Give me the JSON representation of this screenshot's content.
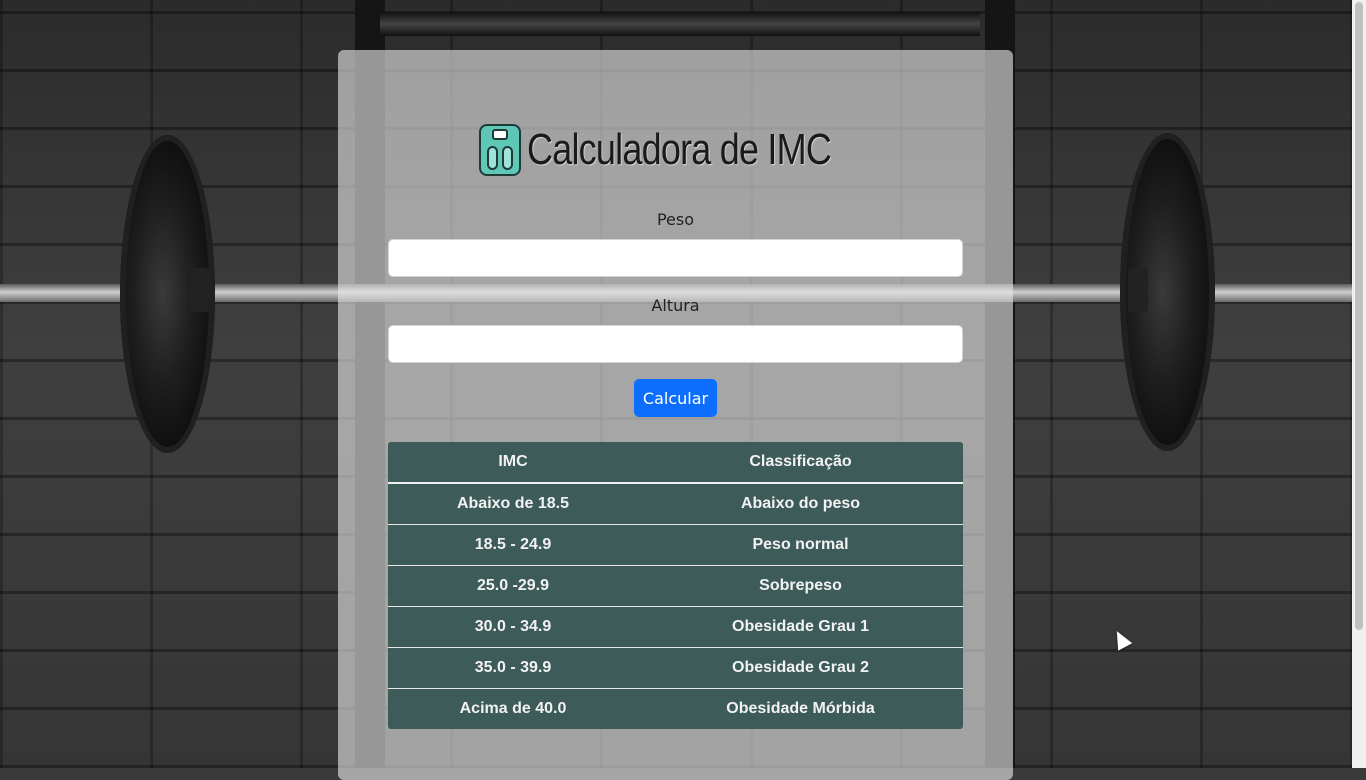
{
  "app": {
    "title": "Calculadora de IMC",
    "logo_icon": "scale-icon"
  },
  "form": {
    "peso_label": "Peso",
    "peso_value": "",
    "altura_label": "Altura",
    "altura_value": "",
    "calc_button": "Calcular",
    "accent_color": "#0d6efd"
  },
  "table": {
    "headers": [
      "IMC",
      "Classificação"
    ],
    "rows": [
      [
        "Abaixo de 18.5",
        "Abaixo do peso"
      ],
      [
        "18.5 - 24.9",
        "Peso normal"
      ],
      [
        "25.0 -29.9",
        "Sobrepeso"
      ],
      [
        "30.0 - 34.9",
        "Obesidade Grau 1"
      ],
      [
        "35.0 - 39.9",
        "Obesidade Grau 2"
      ],
      [
        "Acima de 40.0",
        "Obesidade Mórbida"
      ]
    ],
    "row_color": "#3d5b59"
  }
}
